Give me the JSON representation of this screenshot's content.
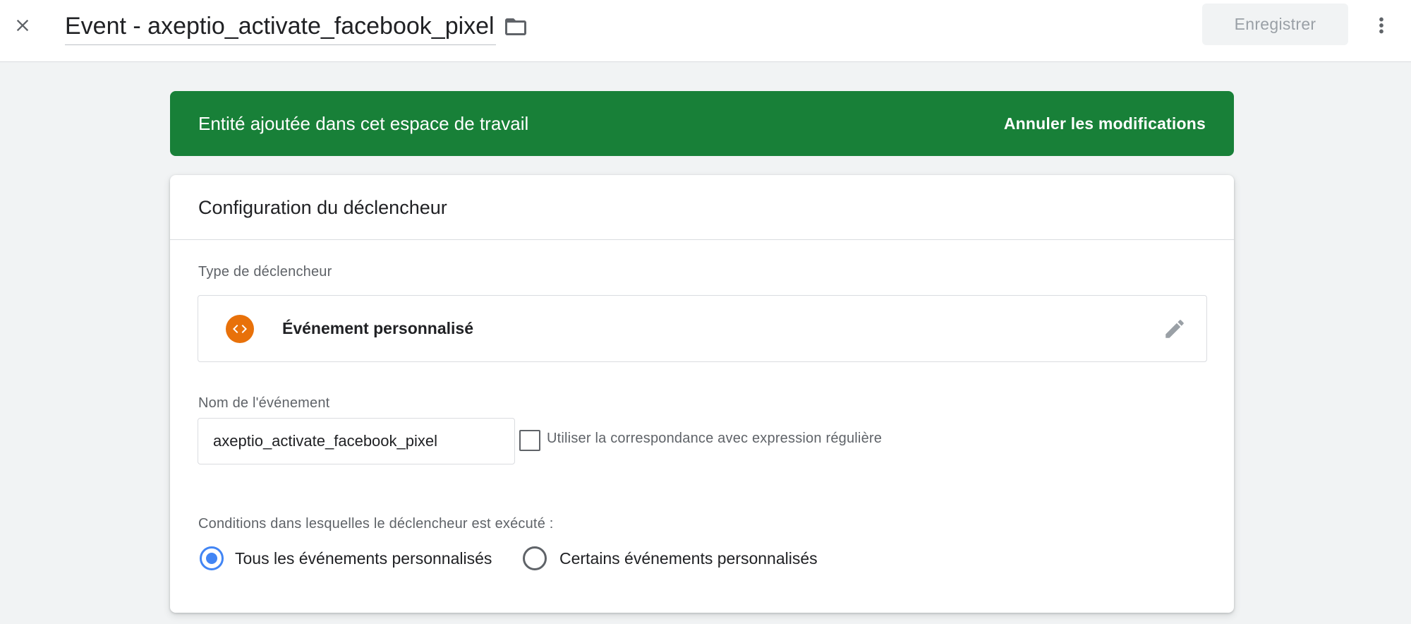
{
  "header": {
    "title": "Event - axeptio_activate_facebook_pixel",
    "save_label": "Enregistrer",
    "icons": {
      "close": "close-icon",
      "folder": "folder-icon",
      "more": "more-vert-icon"
    }
  },
  "banner": {
    "message": "Entité ajoutée dans cet espace de travail",
    "action_label": "Annuler les modifications",
    "color": "#188038"
  },
  "card": {
    "title": "Configuration du déclencheur",
    "trigger_type": {
      "label": "Type de déclencheur",
      "value": "Événement personnalisé",
      "icon": "custom-event-code-icon",
      "icon_color": "#e8710a"
    },
    "event_name": {
      "label": "Nom de l'événement",
      "value": "axeptio_activate_facebook_pixel"
    },
    "regex_option": {
      "label": "Utiliser la correspondance avec expression régulière",
      "checked": false
    },
    "conditions": {
      "label": "Conditions dans lesquelles le déclencheur est exécuté :",
      "options": [
        {
          "label": "Tous les événements personnalisés",
          "selected": true
        },
        {
          "label": "Certains événements personnalisés",
          "selected": false
        }
      ],
      "accent_color": "#4285f4"
    }
  }
}
